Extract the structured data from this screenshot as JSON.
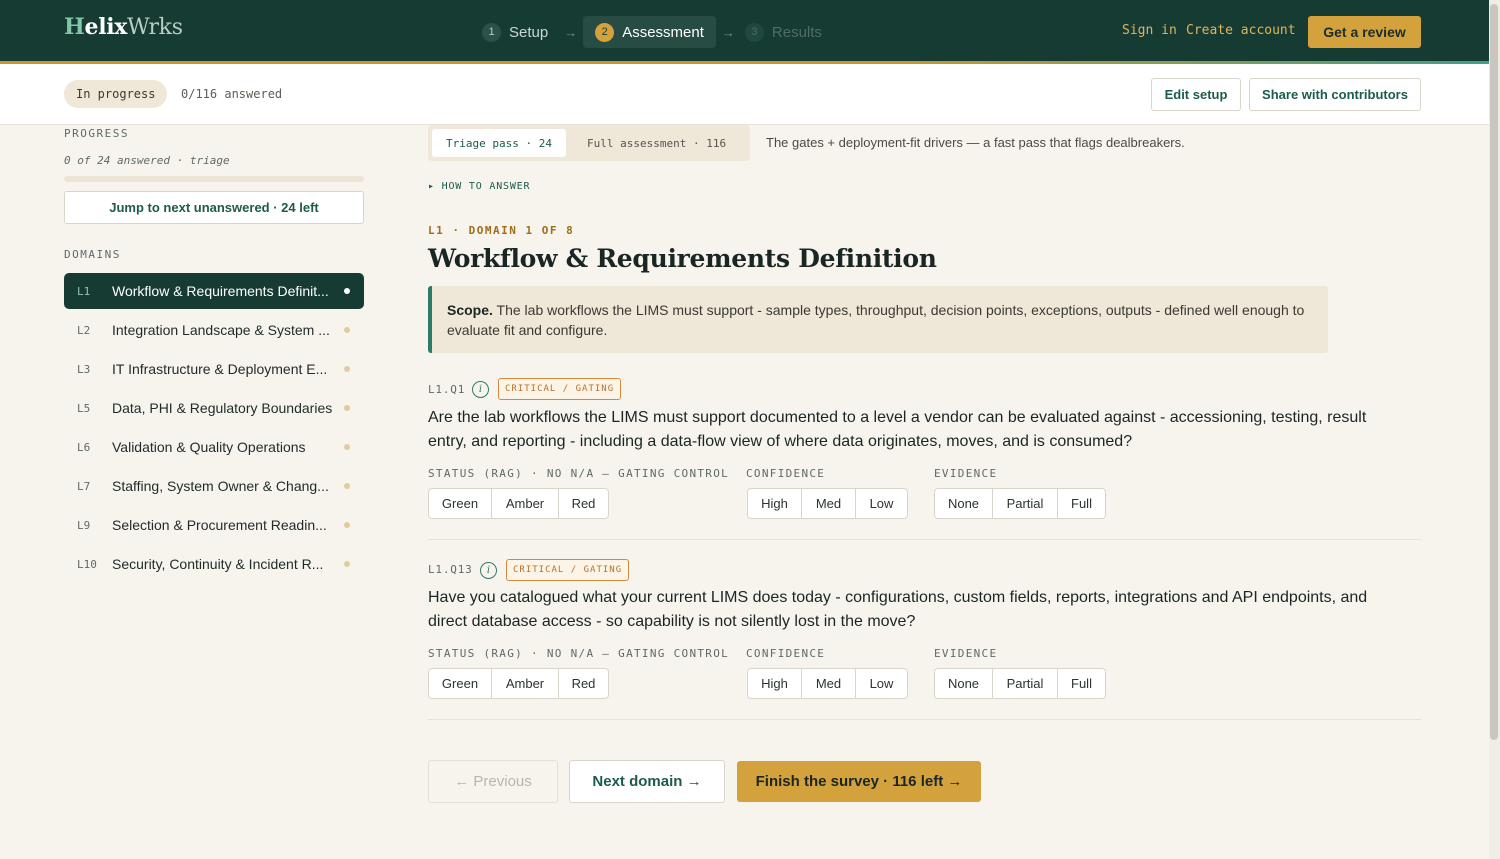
{
  "brand": {
    "logo_first": "H",
    "logo_mid": "elix",
    "logo_last": "Wrks"
  },
  "steps": [
    {
      "num": "1",
      "label": "Setup",
      "state": "done"
    },
    {
      "num": "2",
      "label": "Assessment",
      "state": "active"
    },
    {
      "num": "3",
      "label": "Results",
      "state": "upcoming"
    }
  ],
  "nav": {
    "sign_in": "Sign in",
    "create_account": "Create account",
    "cta": "Get a review"
  },
  "subheader": {
    "status": "In progress",
    "answered": "0/116 answered",
    "edit_setup": "Edit setup",
    "share": "Share with contributors"
  },
  "sidebar": {
    "progress_label": "PROGRESS",
    "progress_text": "0 of 24 answered · triage",
    "progress_fraction": 0,
    "jump_button": "Jump to next unanswered · 24 left",
    "domains_label": "DOMAINS",
    "domains": [
      {
        "code": "L1",
        "name": "Workflow & Requirements Definit...",
        "active": true
      },
      {
        "code": "L2",
        "name": "Integration Landscape & System ...",
        "active": false
      },
      {
        "code": "L3",
        "name": "IT Infrastructure & Deployment E...",
        "active": false
      },
      {
        "code": "L5",
        "name": "Data, PHI & Regulatory Boundaries",
        "active": false
      },
      {
        "code": "L6",
        "name": "Validation & Quality Operations",
        "active": false
      },
      {
        "code": "L7",
        "name": "Staffing, System Owner & Chang...",
        "active": false
      },
      {
        "code": "L9",
        "name": "Selection & Procurement Readin...",
        "active": false
      },
      {
        "code": "L10",
        "name": "Security, Continuity & Incident R...",
        "active": false
      }
    ]
  },
  "mode": {
    "triage": "Triage pass · 24",
    "full": "Full assessment · 116",
    "description": "The gates + deployment-fit drivers — a fast pass that flags dealbreakers."
  },
  "how_to": "▸ HOW TO ANSWER",
  "domain": {
    "meta": "L1 · DOMAIN 1 OF 8",
    "title": "Workflow & Requirements Definition",
    "scope_label": "Scope.",
    "scope_text": "The lab workflows the LIMS must support - sample types, throughput, decision points, exceptions, outputs - defined well enough to evaluate fit and configure."
  },
  "field_labels": {
    "status": "STATUS (RAG) · NO N/A — GATING CONTROL",
    "confidence": "CONFIDENCE",
    "evidence": "EVIDENCE"
  },
  "options": {
    "status": [
      "Green",
      "Amber",
      "Red"
    ],
    "confidence": [
      "High",
      "Med",
      "Low"
    ],
    "evidence": [
      "None",
      "Partial",
      "Full"
    ]
  },
  "questions": [
    {
      "code": "L1.Q1",
      "badge": "CRITICAL / GATING",
      "text": "Are the lab workflows the LIMS must support documented to a level a vendor can be evaluated against - accessioning, testing, result entry, and reporting - including a data-flow view of where data originates, moves, and is consumed?"
    },
    {
      "code": "L1.Q13",
      "badge": "CRITICAL / GATING",
      "text": "Have you catalogued what your current LIMS does today - configurations, custom fields, reports, integrations and API endpoints, and direct database access - so capability is not silently lost in the move?"
    }
  ],
  "footer": {
    "previous": "← Previous",
    "next": "Next domain →",
    "finish": "Finish the survey · 116 left →"
  },
  "colors": {
    "nav_bg": "#163b33",
    "accent_gold": "#d4a23c",
    "accent_green": "#2f7a66",
    "page_bg": "#f7f4ee"
  }
}
